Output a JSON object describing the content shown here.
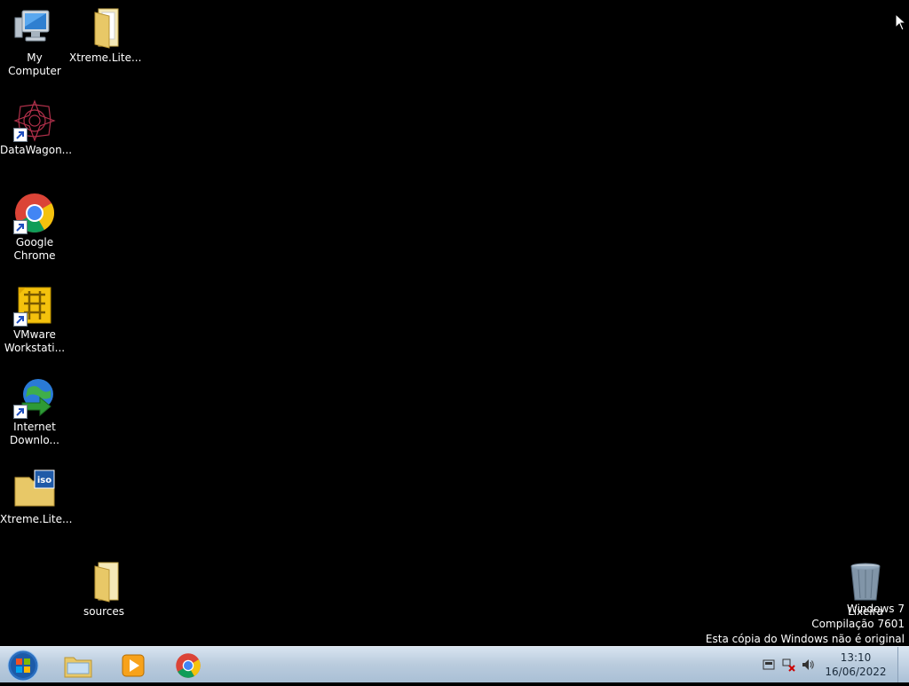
{
  "desktop": {
    "icons": [
      {
        "label": "My Computer"
      },
      {
        "label": "Xtreme.Lite..."
      },
      {
        "label": "DataWagon..."
      },
      {
        "label": "Google\nChrome"
      },
      {
        "label": "VMware\nWorkstati..."
      },
      {
        "label": "Internet\nDownlo..."
      },
      {
        "label": "Xtreme.Lite..."
      },
      {
        "label": "sources"
      },
      {
        "label": "Lixeira"
      }
    ]
  },
  "watermark": {
    "line1": "Windows 7",
    "line2": "Compilação 7601",
    "line3": "Esta cópia do Windows não é original"
  },
  "taskbar": {
    "clock_time": "13:10",
    "clock_date": "16/06/2022"
  },
  "colors": {
    "desktop_bg": "#000000",
    "taskbar_top": "#d8e4f0",
    "taskbar_bottom": "#a9bfd5"
  }
}
